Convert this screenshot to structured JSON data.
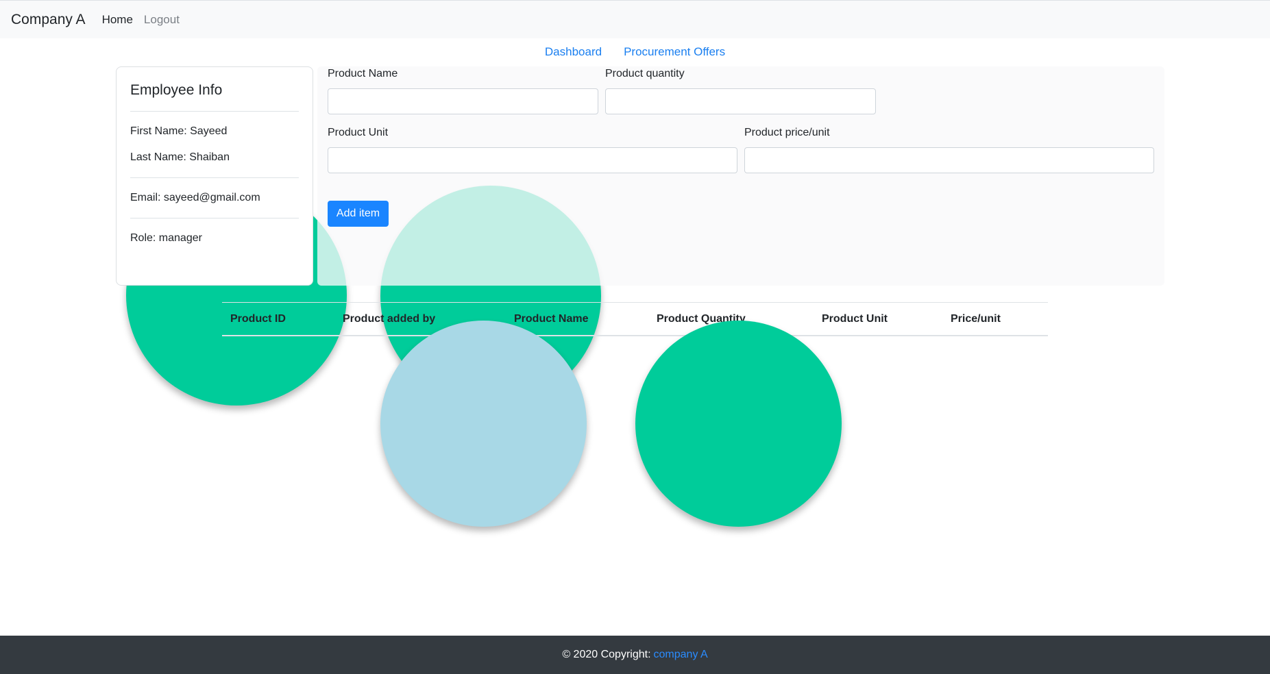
{
  "navbar": {
    "brand": "Company A",
    "home": "Home",
    "logout": "Logout"
  },
  "subnav": {
    "dashboard": "Dashboard",
    "procurement": "Procurement Offers"
  },
  "employee": {
    "title": "Employee Info",
    "first_name": "First Name: Sayeed",
    "last_name": "Last Name: Shaiban",
    "email": "Email: sayeed@gmail.com",
    "role": "Role: manager"
  },
  "form": {
    "product_name_label": "Product Name",
    "product_quantity_label": "Product quantity",
    "product_unit_label": "Product Unit",
    "product_price_label": "Product price/unit",
    "add_button": "Add item"
  },
  "table": {
    "headers": [
      "Product ID",
      "Product added by",
      "Product Name",
      "Product Quantity",
      "Product Unit",
      "Price/unit"
    ]
  },
  "footer": {
    "text": "© 2020 Copyright:",
    "link": "company A"
  },
  "colors": {
    "accent": "#1a85ff",
    "circle_green": "#00cc9a",
    "circle_blue": "#a8d8e6",
    "footer_bg": "#343a40"
  }
}
